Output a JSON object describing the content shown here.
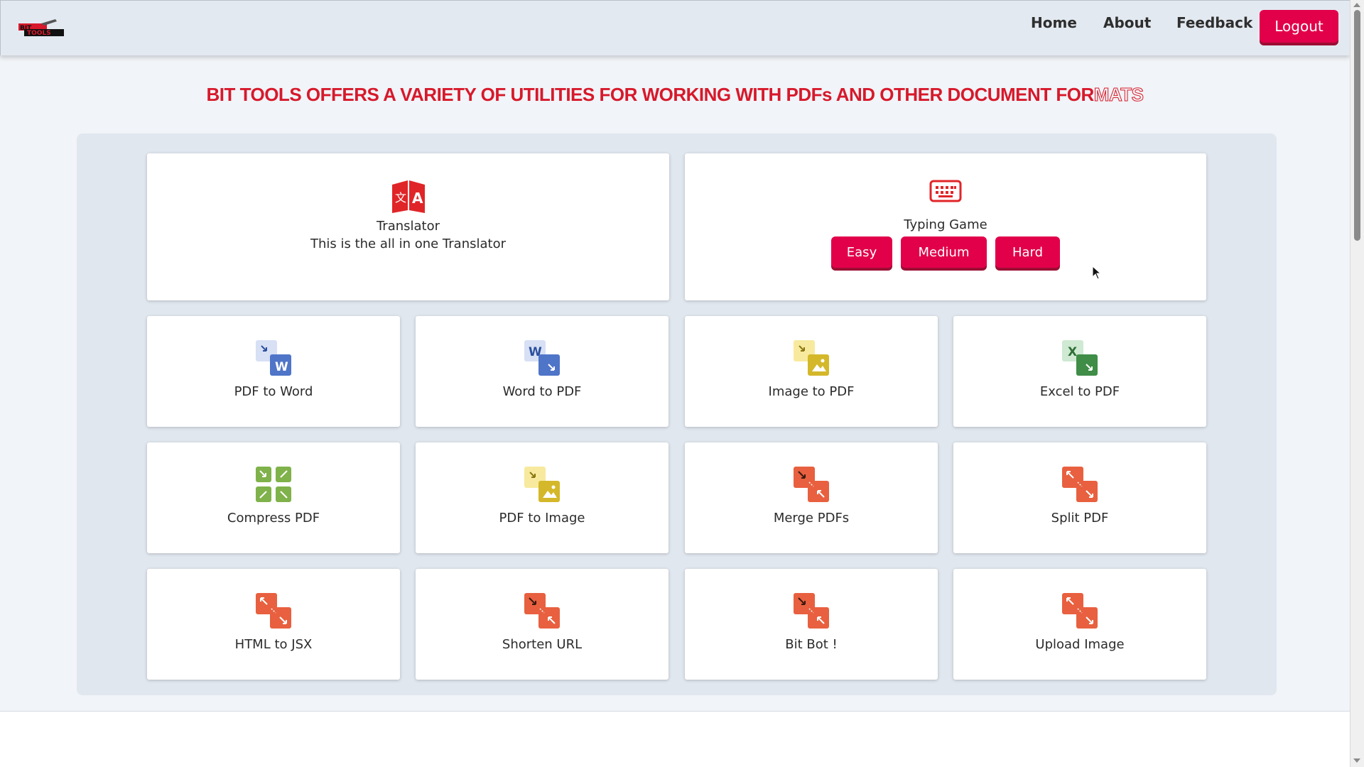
{
  "brand": {
    "logo_text": "BIT TOOLS"
  },
  "nav": {
    "home": "Home",
    "about": "About",
    "feedback": "Feedback",
    "logout": "Logout"
  },
  "headline": {
    "main": "BIT TOOLS OFFERS A VARIETY OF UTILITIES FOR WORKING WITH PDFs AND OTHER DOCUMENT FOR",
    "outline": "MATS"
  },
  "featured": {
    "translator": {
      "title": "Translator",
      "subtitle": "This is the all in one Translator",
      "icon": "translate-icon"
    },
    "typing": {
      "title": "Typing Game",
      "icon": "keyboard-icon",
      "levels": [
        "Easy",
        "Medium",
        "Hard"
      ]
    }
  },
  "tools": [
    {
      "label": "PDF to Word",
      "icon": "pdf-to-word-icon"
    },
    {
      "label": "Word to PDF",
      "icon": "word-to-pdf-icon"
    },
    {
      "label": "Image to PDF",
      "icon": "image-to-pdf-icon"
    },
    {
      "label": "Excel to PDF",
      "icon": "excel-to-pdf-icon"
    },
    {
      "label": "Compress PDF",
      "icon": "compress-icon"
    },
    {
      "label": "PDF to Image",
      "icon": "pdf-to-image-icon"
    },
    {
      "label": "Merge PDFs",
      "icon": "merge-icon"
    },
    {
      "label": "Split PDF",
      "icon": "split-icon"
    },
    {
      "label": "HTML to JSX",
      "icon": "expand-icon"
    },
    {
      "label": "Shorten URL",
      "icon": "merge-icon"
    },
    {
      "label": "Bit Bot !",
      "icon": "merge-icon"
    },
    {
      "label": "Upload Image",
      "icon": "expand-icon"
    }
  ],
  "colors": {
    "accent": "#e2004a",
    "headline": "#d7192b",
    "word": "#4f75c8",
    "excel": "#3f8d47",
    "image": "#d4b82a",
    "compress": "#7fb24a",
    "pdf": "#e8603f"
  }
}
